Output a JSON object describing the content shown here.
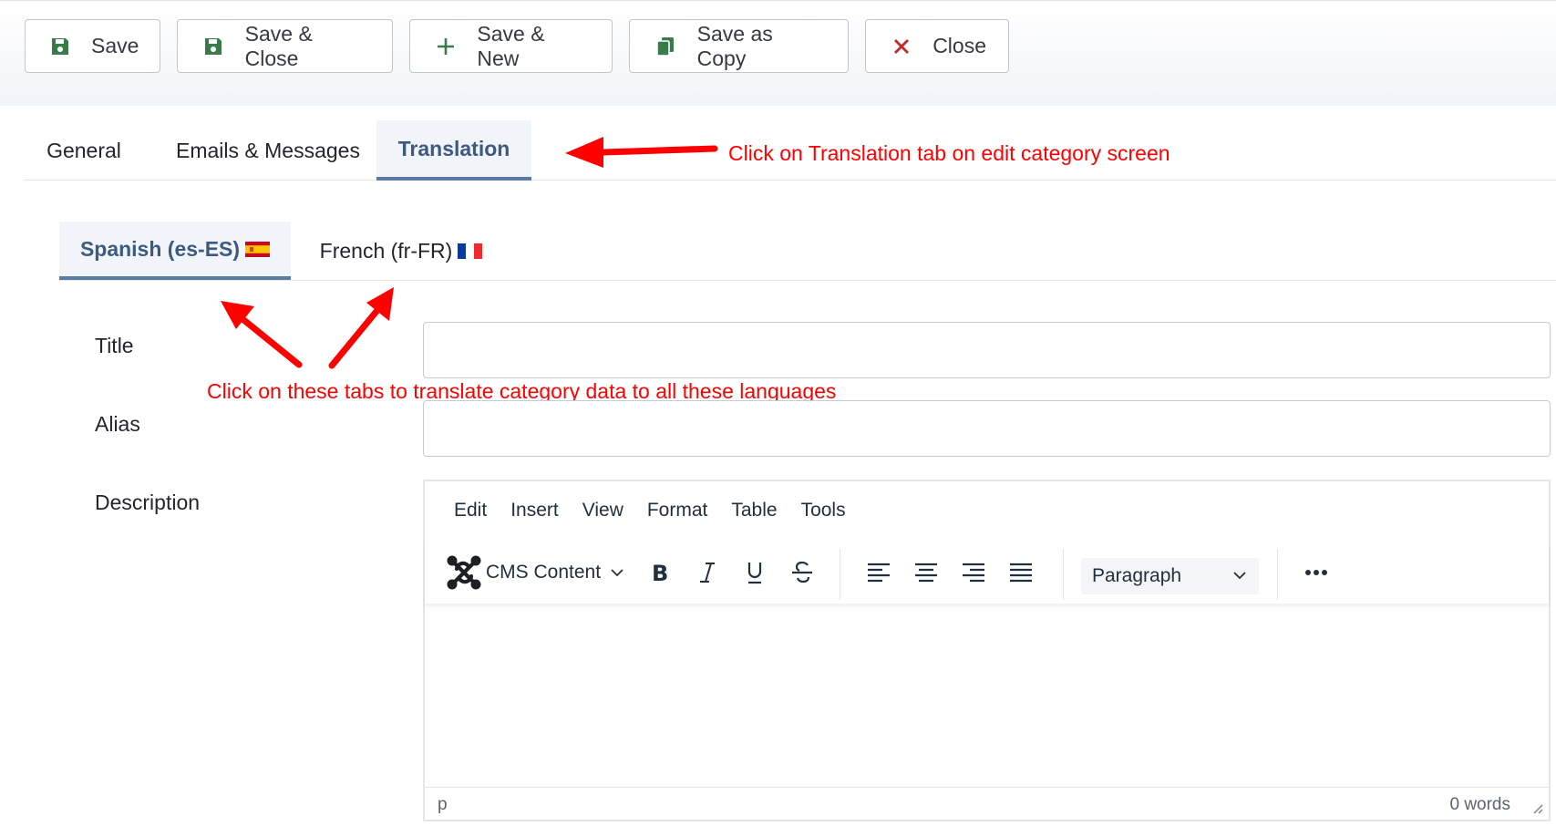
{
  "toolbar": {
    "save": "Save",
    "save_close": "Save & Close",
    "save_new": "Save & New",
    "save_copy": "Save as Copy",
    "close": "Close"
  },
  "tabs": {
    "general": "General",
    "emails": "Emails & Messages",
    "translation": "Translation"
  },
  "annotations": {
    "translation_tab": "Click on Translation tab on edit category screen",
    "language_tabs": "Click on these tabs to translate category data to all these languages"
  },
  "languages": {
    "spanish": "Spanish (es-ES)",
    "french": "French (fr-FR)"
  },
  "form": {
    "title_label": "Title",
    "title_value": "",
    "alias_label": "Alias",
    "alias_value": "",
    "description_label": "Description"
  },
  "editor": {
    "menu": [
      "Edit",
      "Insert",
      "View",
      "Format",
      "Table",
      "Tools"
    ],
    "cms_content": "CMS Content",
    "block_format": "Paragraph",
    "status_path": "p",
    "word_count": "0 words"
  },
  "colors": {
    "accent": "#3d5a80",
    "save_icon": "#3b7a4a",
    "close_icon": "#c52827",
    "annotation": "#ff0000"
  }
}
